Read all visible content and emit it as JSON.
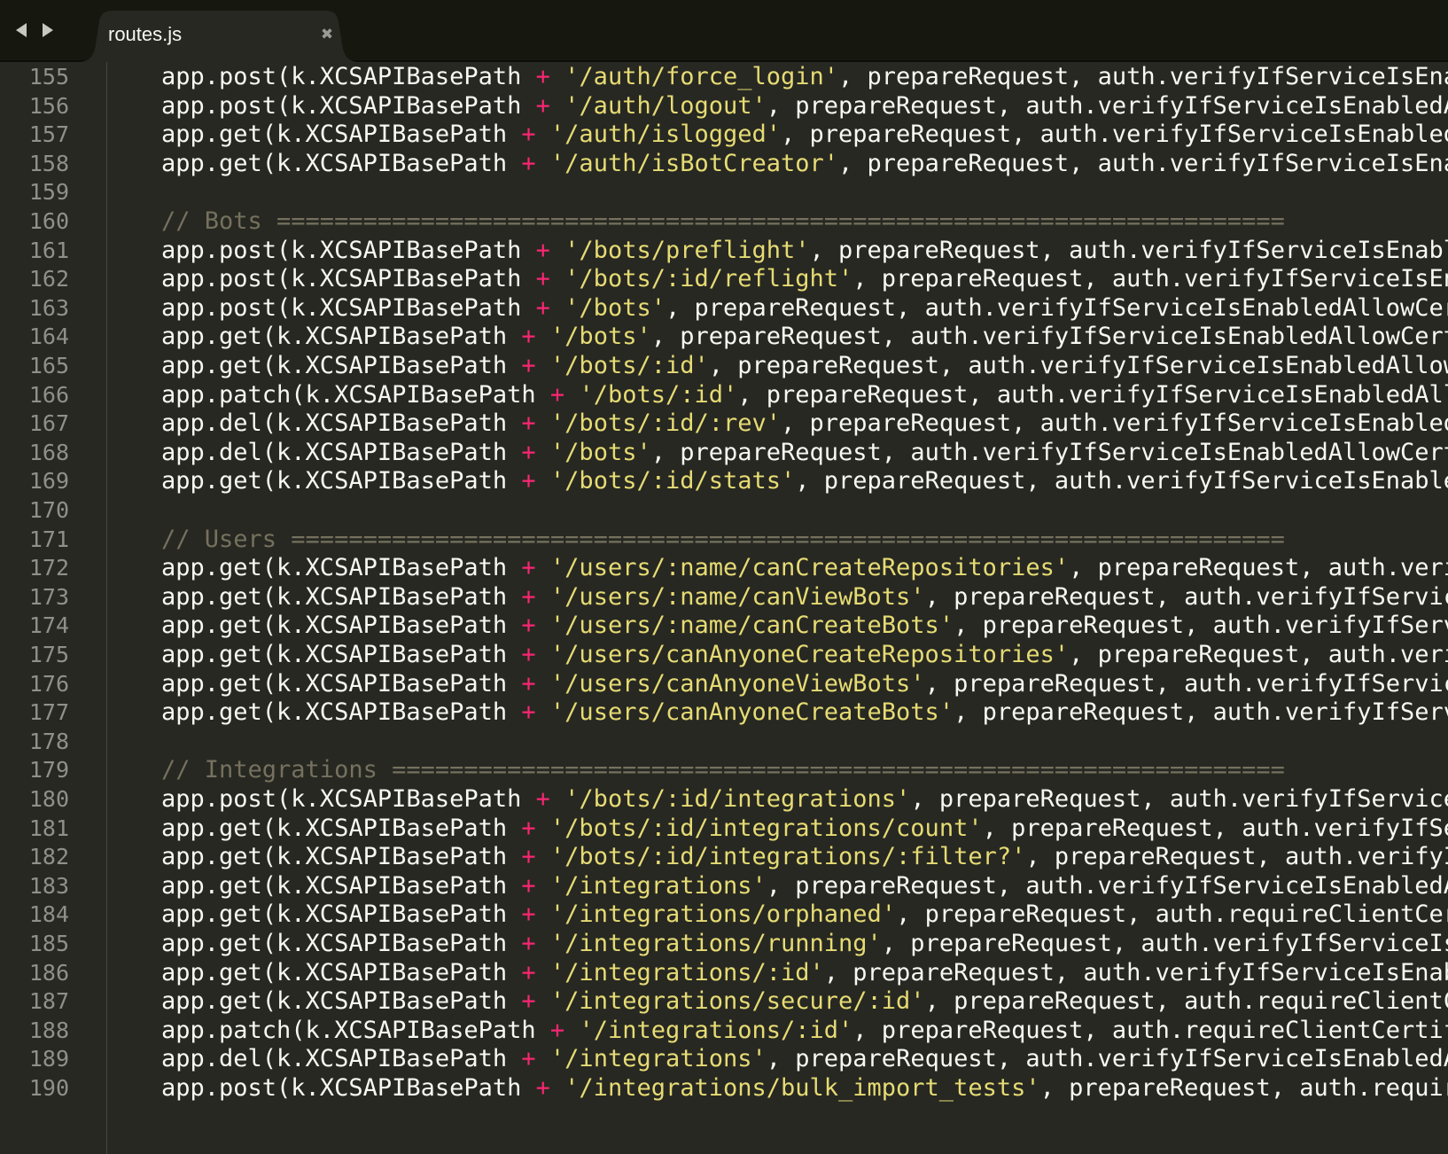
{
  "tab": {
    "filename": "routes.js",
    "close_glyph": "✖"
  },
  "navigation": {
    "back_icon": "triangle-left",
    "forward_icon": "triangle-right"
  },
  "colors": {
    "background": "#272822",
    "keyword_operator": "#f92672",
    "string": "#e6db74",
    "comment": "#75715e",
    "text": "#f8f8f2",
    "line_number": "#8f908a"
  },
  "lines": [
    {
      "number": "155",
      "tokens": [
        {
          "t": "plain",
          "v": "    app.post(k.XCSAPIBasePath "
        },
        {
          "t": "op",
          "v": "+"
        },
        {
          "t": "plain",
          "v": " "
        },
        {
          "t": "str",
          "v": "'/auth/force_login'"
        },
        {
          "t": "plain",
          "v": ", prepareRequest, auth.verifyIfServiceIsEnab"
        }
      ]
    },
    {
      "number": "156",
      "tokens": [
        {
          "t": "plain",
          "v": "    app.post(k.XCSAPIBasePath "
        },
        {
          "t": "op",
          "v": "+"
        },
        {
          "t": "plain",
          "v": " "
        },
        {
          "t": "str",
          "v": "'/auth/logout'"
        },
        {
          "t": "plain",
          "v": ", prepareRequest, auth.verifyIfServiceIsEnabledAl"
        }
      ]
    },
    {
      "number": "157",
      "tokens": [
        {
          "t": "plain",
          "v": "    app.get(k.XCSAPIBasePath "
        },
        {
          "t": "op",
          "v": "+"
        },
        {
          "t": "plain",
          "v": " "
        },
        {
          "t": "str",
          "v": "'/auth/islogged'"
        },
        {
          "t": "plain",
          "v": ", prepareRequest, auth.verifyIfServiceIsEnabledA"
        }
      ]
    },
    {
      "number": "158",
      "tokens": [
        {
          "t": "plain",
          "v": "    app.get(k.XCSAPIBasePath "
        },
        {
          "t": "op",
          "v": "+"
        },
        {
          "t": "plain",
          "v": " "
        },
        {
          "t": "str",
          "v": "'/auth/isBotCreator'"
        },
        {
          "t": "plain",
          "v": ", prepareRequest, auth.verifyIfServiceIsEnab"
        }
      ]
    },
    {
      "number": "159",
      "tokens": []
    },
    {
      "number": "160",
      "tokens": [
        {
          "t": "plain",
          "v": "    "
        },
        {
          "t": "comment",
          "v": "// Bots ======================================================================"
        }
      ]
    },
    {
      "number": "161",
      "tokens": [
        {
          "t": "plain",
          "v": "    app.post(k.XCSAPIBasePath "
        },
        {
          "t": "op",
          "v": "+"
        },
        {
          "t": "plain",
          "v": " "
        },
        {
          "t": "str",
          "v": "'/bots/preflight'"
        },
        {
          "t": "plain",
          "v": ", prepareRequest, auth.verifyIfServiceIsEnable"
        }
      ]
    },
    {
      "number": "162",
      "tokens": [
        {
          "t": "plain",
          "v": "    app.post(k.XCSAPIBasePath "
        },
        {
          "t": "op",
          "v": "+"
        },
        {
          "t": "plain",
          "v": " "
        },
        {
          "t": "str",
          "v": "'/bots/:id/reflight'"
        },
        {
          "t": "plain",
          "v": ", prepareRequest, auth.verifyIfServiceIsEna"
        }
      ]
    },
    {
      "number": "163",
      "tokens": [
        {
          "t": "plain",
          "v": "    app.post(k.XCSAPIBasePath "
        },
        {
          "t": "op",
          "v": "+"
        },
        {
          "t": "plain",
          "v": " "
        },
        {
          "t": "str",
          "v": "'/bots'"
        },
        {
          "t": "plain",
          "v": ", prepareRequest, auth.verifyIfServiceIsEnabledAllowCert"
        }
      ]
    },
    {
      "number": "164",
      "tokens": [
        {
          "t": "plain",
          "v": "    app.get(k.XCSAPIBasePath "
        },
        {
          "t": "op",
          "v": "+"
        },
        {
          "t": "plain",
          "v": " "
        },
        {
          "t": "str",
          "v": "'/bots'"
        },
        {
          "t": "plain",
          "v": ", prepareRequest, auth.verifyIfServiceIsEnabledAllowCerti"
        }
      ]
    },
    {
      "number": "165",
      "tokens": [
        {
          "t": "plain",
          "v": "    app.get(k.XCSAPIBasePath "
        },
        {
          "t": "op",
          "v": "+"
        },
        {
          "t": "plain",
          "v": " "
        },
        {
          "t": "str",
          "v": "'/bots/:id'"
        },
        {
          "t": "plain",
          "v": ", prepareRequest, auth.verifyIfServiceIsEnabledAllowC"
        }
      ]
    },
    {
      "number": "166",
      "tokens": [
        {
          "t": "plain",
          "v": "    app.patch(k.XCSAPIBasePath "
        },
        {
          "t": "op",
          "v": "+"
        },
        {
          "t": "plain",
          "v": " "
        },
        {
          "t": "str",
          "v": "'/bots/:id'"
        },
        {
          "t": "plain",
          "v": ", prepareRequest, auth.verifyIfServiceIsEnabledAllo"
        }
      ]
    },
    {
      "number": "167",
      "tokens": [
        {
          "t": "plain",
          "v": "    app.del(k.XCSAPIBasePath "
        },
        {
          "t": "op",
          "v": "+"
        },
        {
          "t": "plain",
          "v": " "
        },
        {
          "t": "str",
          "v": "'/bots/:id/:rev'"
        },
        {
          "t": "plain",
          "v": ", prepareRequest, auth.verifyIfServiceIsEnabledA"
        }
      ]
    },
    {
      "number": "168",
      "tokens": [
        {
          "t": "plain",
          "v": "    app.del(k.XCSAPIBasePath "
        },
        {
          "t": "op",
          "v": "+"
        },
        {
          "t": "plain",
          "v": " "
        },
        {
          "t": "str",
          "v": "'/bots'"
        },
        {
          "t": "plain",
          "v": ", prepareRequest, auth.verifyIfServiceIsEnabledAllowCerti"
        }
      ]
    },
    {
      "number": "169",
      "tokens": [
        {
          "t": "plain",
          "v": "    app.get(k.XCSAPIBasePath "
        },
        {
          "t": "op",
          "v": "+"
        },
        {
          "t": "plain",
          "v": " "
        },
        {
          "t": "str",
          "v": "'/bots/:id/stats'"
        },
        {
          "t": "plain",
          "v": ", prepareRequest, auth.verifyIfServiceIsEnabled"
        }
      ]
    },
    {
      "number": "170",
      "tokens": []
    },
    {
      "number": "171",
      "tokens": [
        {
          "t": "plain",
          "v": "    "
        },
        {
          "t": "comment",
          "v": "// Users ====================================================================="
        }
      ]
    },
    {
      "number": "172",
      "tokens": [
        {
          "t": "plain",
          "v": "    app.get(k.XCSAPIBasePath "
        },
        {
          "t": "op",
          "v": "+"
        },
        {
          "t": "plain",
          "v": " "
        },
        {
          "t": "str",
          "v": "'/users/:name/canCreateRepositories'"
        },
        {
          "t": "plain",
          "v": ", prepareRequest, auth.verif"
        }
      ]
    },
    {
      "number": "173",
      "tokens": [
        {
          "t": "plain",
          "v": "    app.get(k.XCSAPIBasePath "
        },
        {
          "t": "op",
          "v": "+"
        },
        {
          "t": "plain",
          "v": " "
        },
        {
          "t": "str",
          "v": "'/users/:name/canViewBots'"
        },
        {
          "t": "plain",
          "v": ", prepareRequest, auth.verifyIfService"
        }
      ]
    },
    {
      "number": "174",
      "tokens": [
        {
          "t": "plain",
          "v": "    app.get(k.XCSAPIBasePath "
        },
        {
          "t": "op",
          "v": "+"
        },
        {
          "t": "plain",
          "v": " "
        },
        {
          "t": "str",
          "v": "'/users/:name/canCreateBots'"
        },
        {
          "t": "plain",
          "v": ", prepareRequest, auth.verifyIfServi"
        }
      ]
    },
    {
      "number": "175",
      "tokens": [
        {
          "t": "plain",
          "v": "    app.get(k.XCSAPIBasePath "
        },
        {
          "t": "op",
          "v": "+"
        },
        {
          "t": "plain",
          "v": " "
        },
        {
          "t": "str",
          "v": "'/users/canAnyoneCreateRepositories'"
        },
        {
          "t": "plain",
          "v": ", prepareRequest, auth.verif"
        }
      ]
    },
    {
      "number": "176",
      "tokens": [
        {
          "t": "plain",
          "v": "    app.get(k.XCSAPIBasePath "
        },
        {
          "t": "op",
          "v": "+"
        },
        {
          "t": "plain",
          "v": " "
        },
        {
          "t": "str",
          "v": "'/users/canAnyoneViewBots'"
        },
        {
          "t": "plain",
          "v": ", prepareRequest, auth.verifyIfService"
        }
      ]
    },
    {
      "number": "177",
      "tokens": [
        {
          "t": "plain",
          "v": "    app.get(k.XCSAPIBasePath "
        },
        {
          "t": "op",
          "v": "+"
        },
        {
          "t": "plain",
          "v": " "
        },
        {
          "t": "str",
          "v": "'/users/canAnyoneCreateBots'"
        },
        {
          "t": "plain",
          "v": ", prepareRequest, auth.verifyIfServi"
        }
      ]
    },
    {
      "number": "178",
      "tokens": []
    },
    {
      "number": "179",
      "tokens": [
        {
          "t": "plain",
          "v": "    "
        },
        {
          "t": "comment",
          "v": "// Integrations =============================================================="
        }
      ]
    },
    {
      "number": "180",
      "tokens": [
        {
          "t": "plain",
          "v": "    app.post(k.XCSAPIBasePath "
        },
        {
          "t": "op",
          "v": "+"
        },
        {
          "t": "plain",
          "v": " "
        },
        {
          "t": "str",
          "v": "'/bots/:id/integrations'"
        },
        {
          "t": "plain",
          "v": ", prepareRequest, auth.verifyIfServiceI"
        }
      ]
    },
    {
      "number": "181",
      "tokens": [
        {
          "t": "plain",
          "v": "    app.get(k.XCSAPIBasePath "
        },
        {
          "t": "op",
          "v": "+"
        },
        {
          "t": "plain",
          "v": " "
        },
        {
          "t": "str",
          "v": "'/bots/:id/integrations/count'"
        },
        {
          "t": "plain",
          "v": ", prepareRequest, auth.verifyIfSer"
        }
      ]
    },
    {
      "number": "182",
      "tokens": [
        {
          "t": "plain",
          "v": "    app.get(k.XCSAPIBasePath "
        },
        {
          "t": "op",
          "v": "+"
        },
        {
          "t": "plain",
          "v": " "
        },
        {
          "t": "str",
          "v": "'/bots/:id/integrations/:filter?'"
        },
        {
          "t": "plain",
          "v": ", prepareRequest, auth.verifyIf"
        }
      ]
    },
    {
      "number": "183",
      "tokens": [
        {
          "t": "plain",
          "v": "    app.get(k.XCSAPIBasePath "
        },
        {
          "t": "op",
          "v": "+"
        },
        {
          "t": "plain",
          "v": " "
        },
        {
          "t": "str",
          "v": "'/integrations'"
        },
        {
          "t": "plain",
          "v": ", prepareRequest, auth.verifyIfServiceIsEnabledAl"
        }
      ]
    },
    {
      "number": "184",
      "tokens": [
        {
          "t": "plain",
          "v": "    app.get(k.XCSAPIBasePath "
        },
        {
          "t": "op",
          "v": "+"
        },
        {
          "t": "plain",
          "v": " "
        },
        {
          "t": "str",
          "v": "'/integrations/orphaned'"
        },
        {
          "t": "plain",
          "v": ", prepareRequest, auth.requireClientCert"
        }
      ]
    },
    {
      "number": "185",
      "tokens": [
        {
          "t": "plain",
          "v": "    app.get(k.XCSAPIBasePath "
        },
        {
          "t": "op",
          "v": "+"
        },
        {
          "t": "plain",
          "v": " "
        },
        {
          "t": "str",
          "v": "'/integrations/running'"
        },
        {
          "t": "plain",
          "v": ", prepareRequest, auth.verifyIfServiceIsE"
        }
      ]
    },
    {
      "number": "186",
      "tokens": [
        {
          "t": "plain",
          "v": "    app.get(k.XCSAPIBasePath "
        },
        {
          "t": "op",
          "v": "+"
        },
        {
          "t": "plain",
          "v": " "
        },
        {
          "t": "str",
          "v": "'/integrations/:id'"
        },
        {
          "t": "plain",
          "v": ", prepareRequest, auth.verifyIfServiceIsEnabl"
        }
      ]
    },
    {
      "number": "187",
      "tokens": [
        {
          "t": "plain",
          "v": "    app.get(k.XCSAPIBasePath "
        },
        {
          "t": "op",
          "v": "+"
        },
        {
          "t": "plain",
          "v": " "
        },
        {
          "t": "str",
          "v": "'/integrations/secure/:id'"
        },
        {
          "t": "plain",
          "v": ", prepareRequest, auth.requireClientCe"
        }
      ]
    },
    {
      "number": "188",
      "tokens": [
        {
          "t": "plain",
          "v": "    app.patch(k.XCSAPIBasePath "
        },
        {
          "t": "op",
          "v": "+"
        },
        {
          "t": "plain",
          "v": " "
        },
        {
          "t": "str",
          "v": "'/integrations/:id'"
        },
        {
          "t": "plain",
          "v": ", prepareRequest, auth.requireClientCertifi"
        }
      ]
    },
    {
      "number": "189",
      "tokens": [
        {
          "t": "plain",
          "v": "    app.del(k.XCSAPIBasePath "
        },
        {
          "t": "op",
          "v": "+"
        },
        {
          "t": "plain",
          "v": " "
        },
        {
          "t": "str",
          "v": "'/integrations'"
        },
        {
          "t": "plain",
          "v": ", prepareRequest, auth.verifyIfServiceIsEnabledAl"
        }
      ]
    },
    {
      "number": "190",
      "tokens": [
        {
          "t": "plain",
          "v": "    app.post(k.XCSAPIBasePath "
        },
        {
          "t": "op",
          "v": "+"
        },
        {
          "t": "plain",
          "v": " "
        },
        {
          "t": "str",
          "v": "'/integrations/bulk_import_tests'"
        },
        {
          "t": "plain",
          "v": ", prepareRequest, auth.require"
        }
      ]
    }
  ]
}
